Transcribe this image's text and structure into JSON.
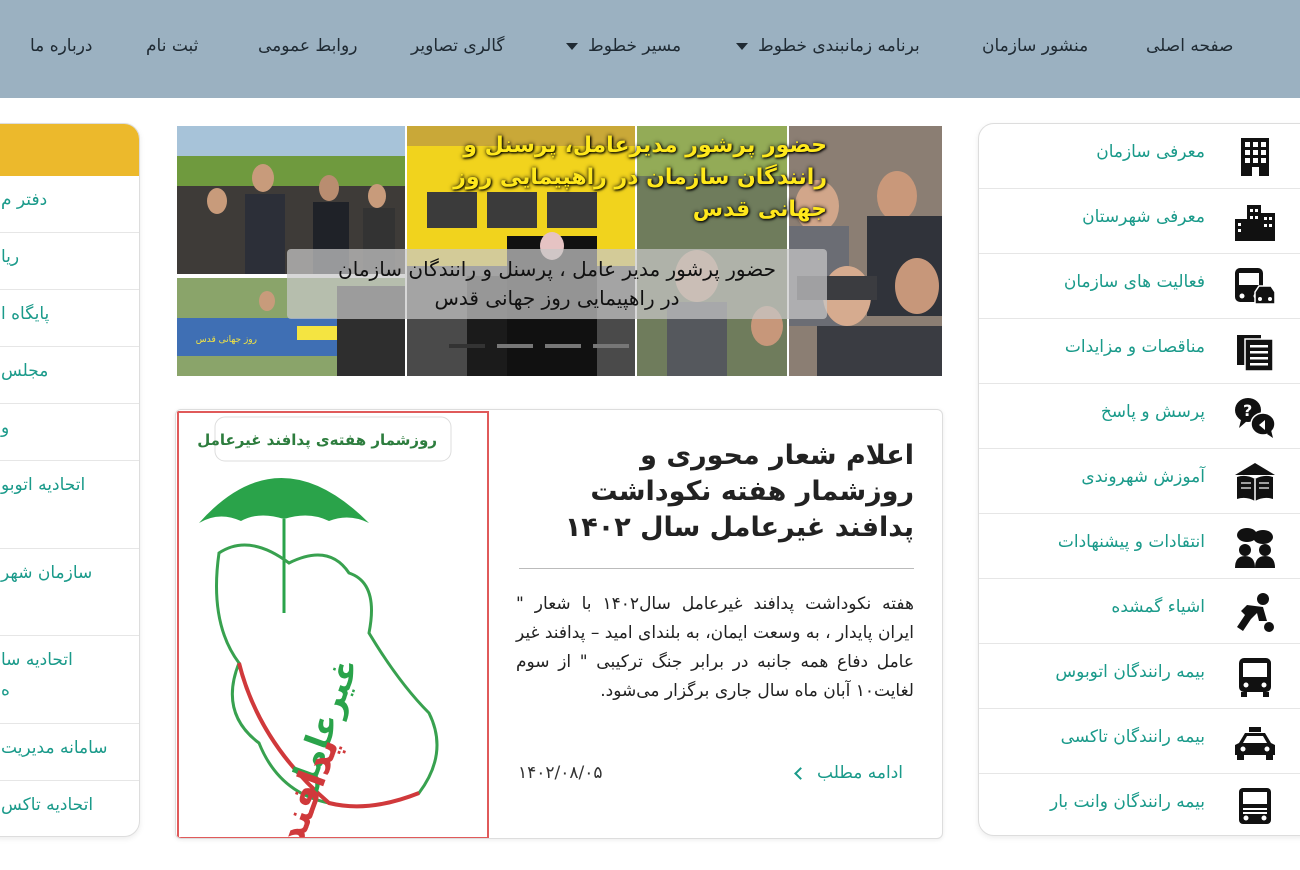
{
  "nav": {
    "items": [
      {
        "label": "صفحه اصلی",
        "dropdown": false
      },
      {
        "label": "منشور سازمان",
        "dropdown": false
      },
      {
        "label": "برنامه زمانبندی خطوط",
        "dropdown": true
      },
      {
        "label": "مسیر خطوط",
        "dropdown": true
      },
      {
        "label": "گالری تصاویر",
        "dropdown": false
      },
      {
        "label": "روابط عمومی",
        "dropdown": false
      },
      {
        "label": "ثبت نام",
        "dropdown": false
      },
      {
        "label": "درباره ما",
        "dropdown": false
      }
    ]
  },
  "right_menu": {
    "items": [
      {
        "label": "معرفی سازمان",
        "icon": "building-icon"
      },
      {
        "label": "معرفی شهرستان",
        "icon": "city-icon"
      },
      {
        "label": "فعالیت های سازمان",
        "icon": "bus-taxi-icon"
      },
      {
        "label": "مناقصات و مزایدات",
        "icon": "documents-icon"
      },
      {
        "label": "پرسش و پاسخ",
        "icon": "question-answer-icon"
      },
      {
        "label": "آموزش شهروندی",
        "icon": "book-house-icon"
      },
      {
        "label": "انتقادات و پیشنهادات",
        "icon": "discussion-icon"
      },
      {
        "label": "اشیاء گمشده",
        "icon": "lost-items-icon"
      },
      {
        "label": "بیمه رانندگان اتوبوس",
        "icon": "bus-icon"
      },
      {
        "label": "بیمه رانندگان تاکسی",
        "icon": "taxi-icon"
      },
      {
        "label": "بیمه رانندگان وانت بار",
        "icon": "truck-icon"
      }
    ]
  },
  "left_menu": {
    "items": [
      {
        "label": "دفتر م"
      },
      {
        "label": "ریا"
      },
      {
        "label": "پایگاه ا"
      },
      {
        "label": "مجلس"
      },
      {
        "label": "و"
      },
      {
        "label": "اتحادیه اتوبو"
      },
      {
        "label": "سازمان شهر"
      },
      {
        "label": "اتحادیه سا",
        "label2": "ه"
      },
      {
        "label": "سامانه مدیریت"
      },
      {
        "label": "اتحادیه تاکس"
      }
    ]
  },
  "slider": {
    "headline": "حضور پرشور مدیرعامل، پرسنل و رانندگان سازمان در راهپیمایی روز جهانی قدس",
    "banner_text": "روز جهانی قدس",
    "caption_line1": "حضور پرشور مدیر عامل ، پرسنل و رانندگان سازمان",
    "caption_line2": "در راهپیمایی روز جهانی قدس"
  },
  "news": {
    "image_caption": "روزشمار هفته‌ی پدافند غیرعامل",
    "image_word1": "پدافند",
    "image_word2": "غیرعامل",
    "title": "اعلام شعار محوری و روزشمار هفته نکوداشت پدافند غیرعامل سال ۱۴۰۲",
    "body": "هفته نکوداشت پدافند غیرعامل سال۱۴۰۲ با شعار \" ایران پایدار ، به وسعت ایمان، به بلندای امید – پدافند غیر عامل دفاع همه جانبه در برابر جنگ ترکیبی \" از سوم لغایت۱۰ آبان ماه سال جاری برگزار می‌شود.",
    "more_label": "ادامه مطلب",
    "date": "۱۴۰۲/۰۸/۰۵"
  },
  "colors": {
    "nav_bg": "#9bb1c1",
    "accent_teal": "#1a9a8a",
    "left_header": "#ecb92c",
    "headline_yellow": "#ffe81c"
  }
}
